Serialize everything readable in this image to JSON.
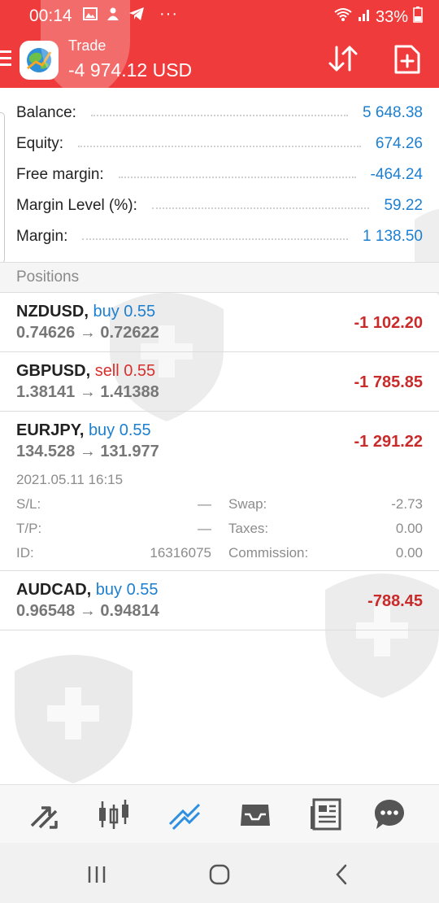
{
  "status_bar": {
    "time": "00:14",
    "battery": "33%"
  },
  "app_bar": {
    "title": "Trade",
    "subtitle": "-4 974.12 USD"
  },
  "account": [
    {
      "label": "Balance:",
      "value": "5 648.38"
    },
    {
      "label": "Equity:",
      "value": "674.26"
    },
    {
      "label": "Free margin:",
      "value": "-464.24"
    },
    {
      "label": "Margin Level (%):",
      "value": "59.22"
    },
    {
      "label": "Margin:",
      "value": "1 138.50"
    }
  ],
  "positions_title": "Positions",
  "positions": [
    {
      "symbol": "NZDUSD,",
      "side": "buy 0.55",
      "prices": "0.74626 → 0.72622",
      "profit": "-1 102.20"
    },
    {
      "symbol": "GBPUSD,",
      "side": "sell 0.55",
      "prices": "1.38141 → 1.41388",
      "profit": "-1 785.85"
    },
    {
      "symbol": "EURJPY,",
      "side": "buy 0.55",
      "prices": "134.528 → 131.977",
      "profit": "-1 291.22",
      "details": {
        "datetime": "2021.05.11 16:15",
        "sl_label": "S/L:",
        "sl_value": "—",
        "tp_label": "T/P:",
        "tp_value": "—",
        "id_label": "ID:",
        "id_value": "16316075",
        "swap_label": "Swap:",
        "swap_value": "-2.73",
        "taxes_label": "Taxes:",
        "taxes_value": "0.00",
        "commission_label": "Commission:",
        "commission_value": "0.00"
      }
    },
    {
      "symbol": "AUDCAD,",
      "side": "buy 0.55",
      "prices": "0.96548 → 0.94814",
      "profit": "-788.45"
    }
  ],
  "colors": {
    "header": "#ef3b3b",
    "value_blue": "#1d7fd0",
    "loss_red": "#c92a2a",
    "sell_red": "#d7302c"
  },
  "icons": {
    "bottom_nav": [
      "quotes-icon",
      "chart-icon",
      "trade-icon",
      "history-icon",
      "news-icon",
      "chat-icon"
    ],
    "system_nav": [
      "recents-icon",
      "home-icon",
      "back-icon"
    ]
  }
}
